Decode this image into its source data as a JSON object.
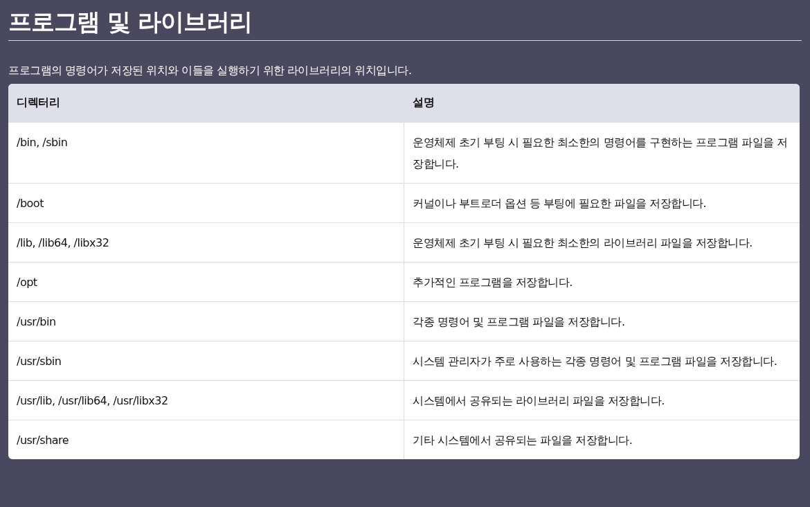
{
  "title": "프로그램 및 라이브러리",
  "description": "프로그램의 명령어가 저장된 위치와 이들을 실행하기 위한 라이브러리의 위치입니다.",
  "table": {
    "columns": [
      "디렉터리",
      "설명"
    ],
    "rows": [
      [
        "/bin, /sbin",
        "운영체제 초기 부팅 시 필요한 최소한의 명령어를 구현하는 프로그램 파일을 저장합니다."
      ],
      [
        "/boot",
        "커널이나 부트로더 옵션 등 부팅에 필요한 파일을 저장합니다."
      ],
      [
        "/lib, /lib64, /libx32",
        "운영체제 초기 부팅 시 필요한 최소한의 라이브러리 파일을 저장합니다."
      ],
      [
        "/opt",
        "추가적인 프로그램을 저장합니다."
      ],
      [
        "/usr/bin",
        "각종 명령어 및 프로그램 파일을 저장합니다."
      ],
      [
        "/usr/sbin",
        "시스템 관리자가 주로 사용하는 각종 명령어 및 프로그램 파일을 저장합니다."
      ],
      [
        "/usr/lib, /usr/lib64, /usr/libx32",
        "시스템에서 공유되는 라이브러리 파일을 저장합니다."
      ],
      [
        "/usr/share",
        "기타 시스템에서 공유되는 파일을 저장합니다."
      ]
    ]
  }
}
